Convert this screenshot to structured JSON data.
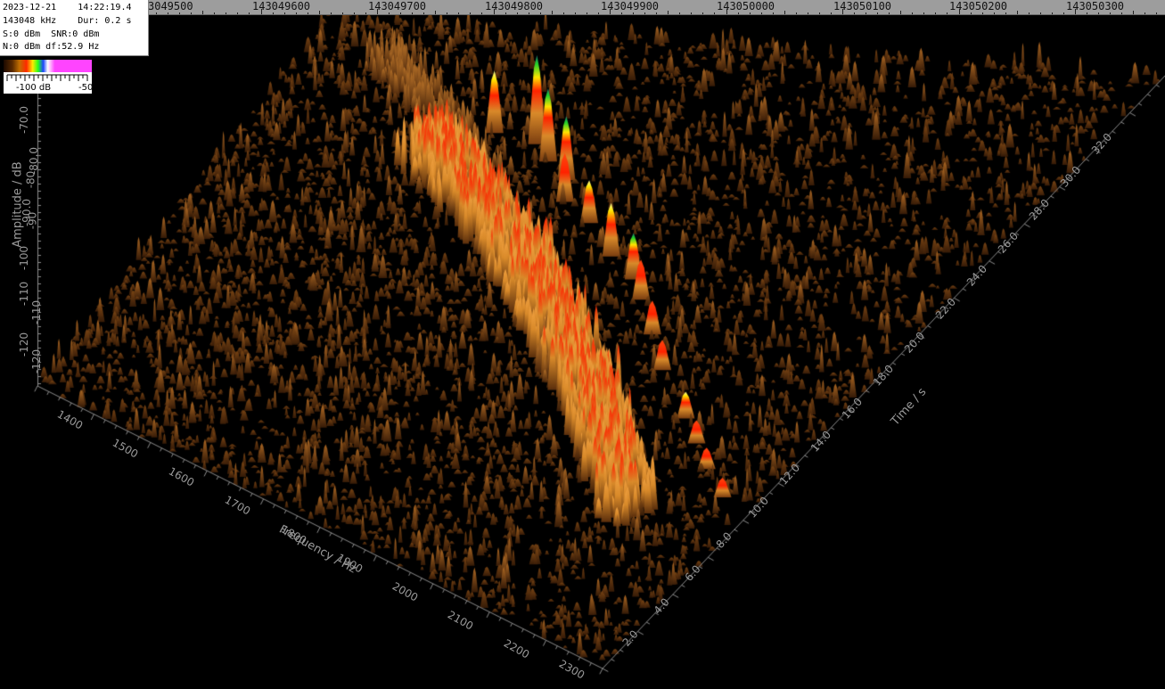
{
  "info_panel": {
    "line1": "2023-12-21    14:22:19.4",
    "line2": "143048 kHz    Dur: 0.2 s",
    "line3": "S:0 dBm  SNR:0 dBm",
    "line4": "N:0 dBm df:52.9 Hz"
  },
  "legend": {
    "min_label": "-100 dB",
    "max_label": "-50"
  },
  "top_ruler": {
    "ticks": [
      "3049500",
      "143049600",
      "143049700",
      "143049800",
      "143049900",
      "143050000",
      "143050100",
      "143050200",
      "143050300"
    ]
  },
  "amplitude_axis": {
    "title": "Amplitude / dB",
    "ticks": [
      "-70.0",
      "-80.0",
      "-80",
      "-90.0",
      "-90",
      "-100",
      "-110",
      "-110",
      "-120",
      "-120"
    ]
  },
  "frequency_axis": {
    "title": "Frequency / Hz",
    "ticks": [
      "1400",
      "1500",
      "1600",
      "1700",
      "1800",
      "1900",
      "2000",
      "2100",
      "2200",
      "2300"
    ]
  },
  "time_axis": {
    "title": "Time / s",
    "ticks": [
      "2.0",
      "4.0",
      "6.0",
      "8.0",
      "10.0",
      "12.0",
      "14.0",
      "16.0",
      "18.0",
      "20.0",
      "22.0",
      "24.0",
      "26.0",
      "28.0",
      "30.0",
      "32.0"
    ]
  },
  "colors": {
    "background": "#000000",
    "ruler": "#9d9d9d",
    "axis": "#8c8c8c",
    "axis_text": "#9a9a9a",
    "noise": "#6b3a12",
    "signal_low": "#d98a2a",
    "signal_mid": "#ff2200",
    "signal_high": "#ffe400",
    "signal_peak": "#22d22a"
  }
}
